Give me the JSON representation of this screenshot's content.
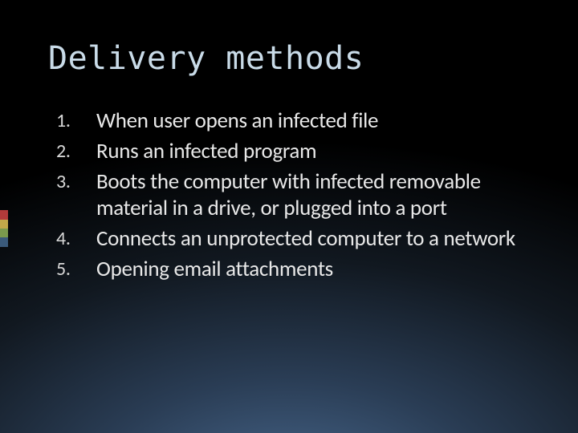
{
  "slide": {
    "title": "Delivery methods",
    "items": [
      "When user opens an infected file",
      "Runs an infected program",
      "Boots the computer with infected removable material in a drive, or plugged into a port",
      "Connects an unprotected computer to a network",
      "Opening email attachments"
    ]
  }
}
